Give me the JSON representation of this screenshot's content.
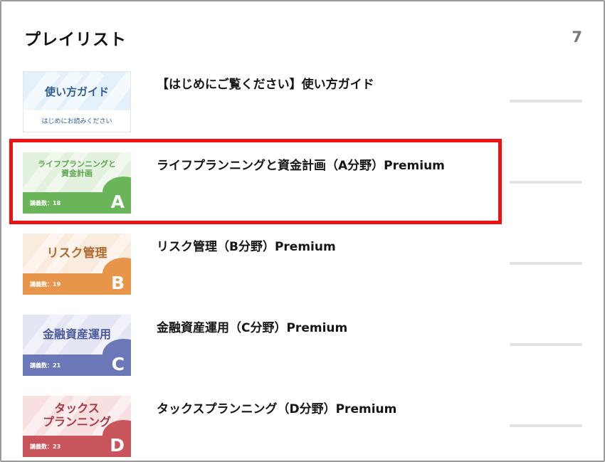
{
  "header": {
    "title": "プレイリスト",
    "count": "7"
  },
  "playlist": [
    {
      "title": "【はじめにご覧ください】使い方ガイド",
      "thumb": {
        "main": "使い方ガイド",
        "sub": "はじめにお読みください"
      }
    },
    {
      "title": "ライフプランニングと資金計画（A分野）Premium",
      "thumb": {
        "main_line1": "ライフプランニングと",
        "main_line2": "資金計画",
        "lessons": "講義数：18",
        "letter": "A",
        "top_color": "#e3f2df",
        "band_color": "#6ab45a",
        "text_color": "#5aa44a"
      }
    },
    {
      "title": "リスク管理（B分野）Premium",
      "thumb": {
        "main_line1": "リスク管理",
        "lessons": "講義数：19",
        "letter": "B",
        "top_color": "#f9ecdf",
        "band_color": "#e8954c",
        "text_color": "#b16a2f"
      }
    },
    {
      "title": "金融資産運用（C分野）Premium",
      "thumb": {
        "main_line1": "金融資産運用",
        "lessons": "講義数：21",
        "letter": "C",
        "top_color": "#e4e6f4",
        "band_color": "#6a78b8",
        "text_color": "#4d5a9c"
      }
    },
    {
      "title": "タックスプランニング（D分野）Premium",
      "thumb": {
        "main_line1": "タックス",
        "main_line2": "プランニング",
        "lessons": "講義数：23",
        "letter": "D",
        "top_color": "#f8e0e0",
        "band_color": "#c8545c",
        "text_color": "#a63a44"
      }
    }
  ],
  "highlight_color": "#ee1111"
}
